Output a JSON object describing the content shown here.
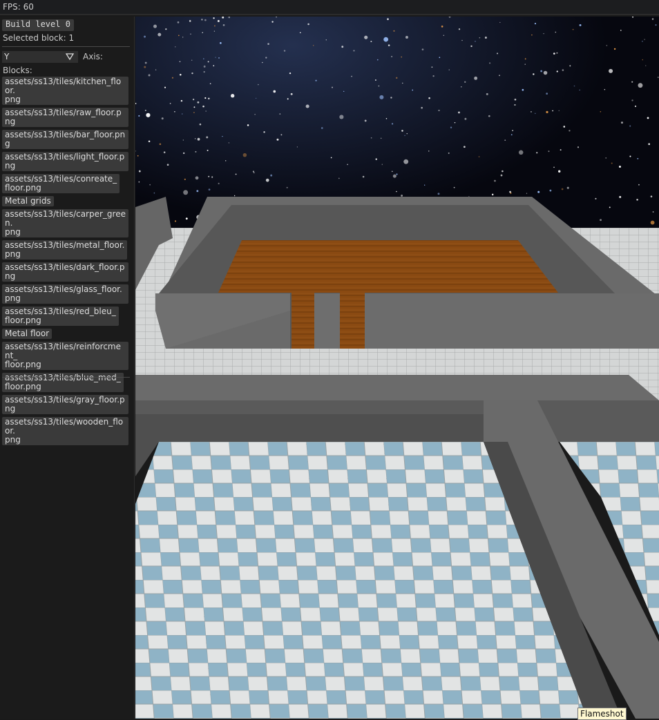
{
  "topbar": {
    "fps": "FPS: 60"
  },
  "panel": {
    "build_button": "Build level 0",
    "selected_block": "Selected block: 1",
    "axis_value": "Y",
    "axis_label": "Axis:",
    "blocks_label": "Blocks:",
    "blocks": [
      "assets/ss13/tiles/kitchen_floor.\npng",
      "assets/ss13/tiles/raw_floor.png",
      "assets/ss13/tiles/bar_floor.png",
      "assets/ss13/tiles/light_floor.png",
      "assets/ss13/tiles/conreate_\nfloor.png",
      "Metal grids",
      "assets/ss13/tiles/carper_green.\npng",
      "assets/ss13/tiles/metal_floor.\npng",
      "assets/ss13/tiles/dark_floor.png",
      "assets/ss13/tiles/glass_floor.png",
      "assets/ss13/tiles/red_bleu_\nfloor.png",
      "Metal floor",
      "assets/ss13/tiles/reinforcment_\nfloor.png",
      "assets/ss13/tiles/blue_med_\nfloor.png",
      "assets/ss13/tiles/gray_floor.png",
      "assets/ss13/tiles/wooden_floor.\npng"
    ]
  },
  "tooltip": "Flameshot",
  "colors": {
    "space": "#06070f",
    "wall": "#6b6b6b",
    "wall_dark": "#4a4a4a",
    "wood": "#8a4a12",
    "tile_blue": "#8fb3c6",
    "tile_white": "#e4e6e6"
  }
}
